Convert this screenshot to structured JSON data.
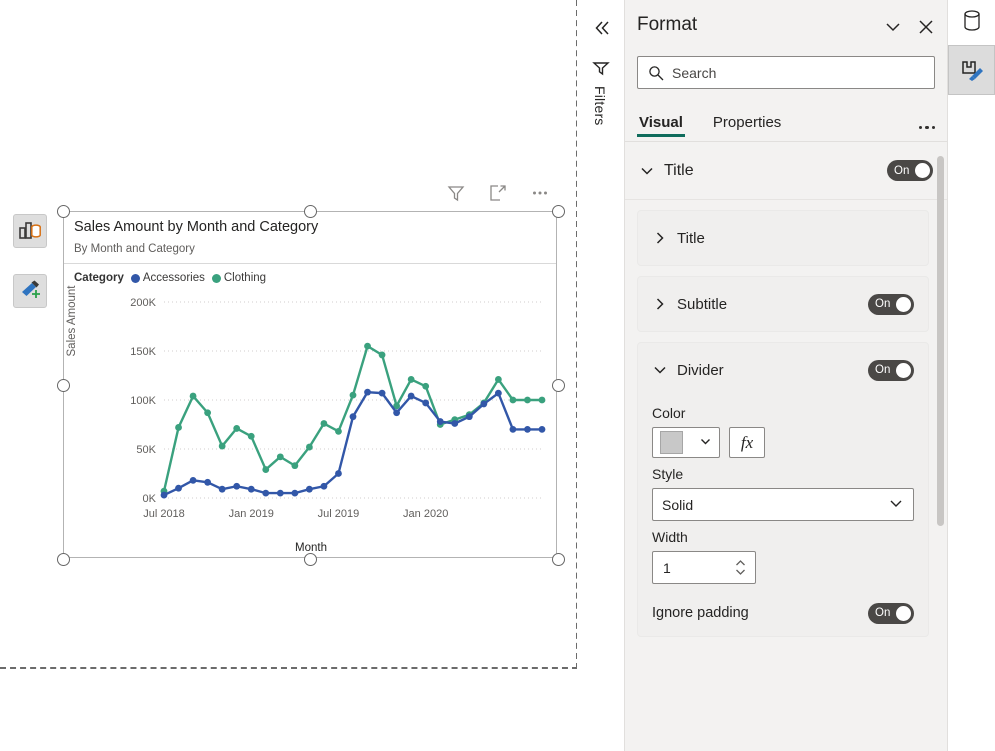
{
  "canvas": {
    "build_visual_icon": "build-visual-icon",
    "format_visual_icon": "format-paint-icon"
  },
  "visual": {
    "title": "Sales Amount by Month and Category",
    "subtitle": "By Month and Category",
    "header_icons": [
      "filter-icon",
      "focus-mode-icon",
      "more-options-icon"
    ],
    "legend": {
      "title": "Category",
      "items": [
        {
          "label": "Accessories",
          "color": "#3257A8"
        },
        {
          "label": "Clothing",
          "color": "#3AA17E"
        }
      ]
    }
  },
  "chart_data": {
    "type": "line",
    "title": "Sales Amount by Month and Category",
    "subtitle": "By Month and Category",
    "xlabel": "Month",
    "ylabel": "Sales Amount",
    "ylim": [
      0,
      200000
    ],
    "yticks": [
      0,
      50000,
      100000,
      150000,
      200000
    ],
    "ytick_labels": [
      "0K",
      "50K",
      "100K",
      "150K",
      "200K"
    ],
    "grid": true,
    "legend_position": "top-left",
    "x": [
      "Jul 2018",
      "Aug 2018",
      "Sep 2018",
      "Oct 2018",
      "Nov 2018",
      "Dec 2018",
      "Jan 2019",
      "Feb 2019",
      "Mar 2019",
      "Apr 2019",
      "May 2019",
      "Jun 2019",
      "Jul 2019",
      "Aug 2019",
      "Sep 2019",
      "Oct 2019",
      "Nov 2019",
      "Dec 2019",
      "Jan 2020",
      "Feb 2020",
      "Mar 2020",
      "Apr 2020",
      "May 2020",
      "Jun 2020",
      "Jul 2020",
      "Aug 2020",
      "Sep 2020"
    ],
    "xtick_labels": [
      "Jul 2018",
      "Jan 2019",
      "Jul 2019",
      "Jan 2020"
    ],
    "xtick_indices": [
      0,
      6,
      12,
      18
    ],
    "series": [
      {
        "name": "Clothing",
        "color": "#3AA17E",
        "values": [
          7000,
          72000,
          104000,
          87000,
          53000,
          71000,
          63000,
          29000,
          42000,
          33000,
          52000,
          76000,
          68000,
          105000,
          155000,
          146000,
          94000,
          121000,
          114000,
          75000,
          80000,
          85000,
          97000,
          121000,
          100000,
          100000,
          100000
        ]
      },
      {
        "name": "Accessories",
        "color": "#3257A8",
        "values": [
          3000,
          10000,
          18000,
          16000,
          9000,
          12000,
          9000,
          5000,
          5000,
          5000,
          9000,
          12000,
          25000,
          83000,
          108000,
          107000,
          87000,
          104000,
          97000,
          78000,
          76000,
          83000,
          96000,
          107000,
          70000,
          70000,
          70000
        ]
      }
    ]
  },
  "filters_pane": {
    "collapse_icon": "double-chevron-left-icon",
    "funnel_icon": "filter-funnel-icon",
    "label": "Filters"
  },
  "format_panel": {
    "title": "Format",
    "collapse_icon": "chevron-down-icon",
    "close_icon": "close-icon",
    "search": {
      "placeholder": "Search",
      "value": "",
      "icon": "search-icon"
    },
    "tabs": [
      {
        "label": "Visual",
        "active": true
      },
      {
        "label": "Properties",
        "active": false
      }
    ],
    "more_menu": "more-options-icon",
    "section": {
      "label": "Title",
      "toggle": "On",
      "expanded": true
    },
    "cards": [
      {
        "label": "Title",
        "expanded": false,
        "toggle": null
      },
      {
        "label": "Subtitle",
        "expanded": false,
        "toggle": "On"
      },
      {
        "label": "Divider",
        "expanded": true,
        "toggle": "On"
      }
    ],
    "divider": {
      "color_label": "Color",
      "color_value": "#c8c8c8",
      "fx_label": "fx",
      "style_label": "Style",
      "style_value": "Solid",
      "width_label": "Width",
      "width_value": "1",
      "ignore_padding_label": "Ignore padding",
      "ignore_padding_toggle": "On"
    }
  },
  "right_rail": {
    "data_icon": "data-cylinder-icon",
    "format_icon": "format-paint-icon"
  }
}
